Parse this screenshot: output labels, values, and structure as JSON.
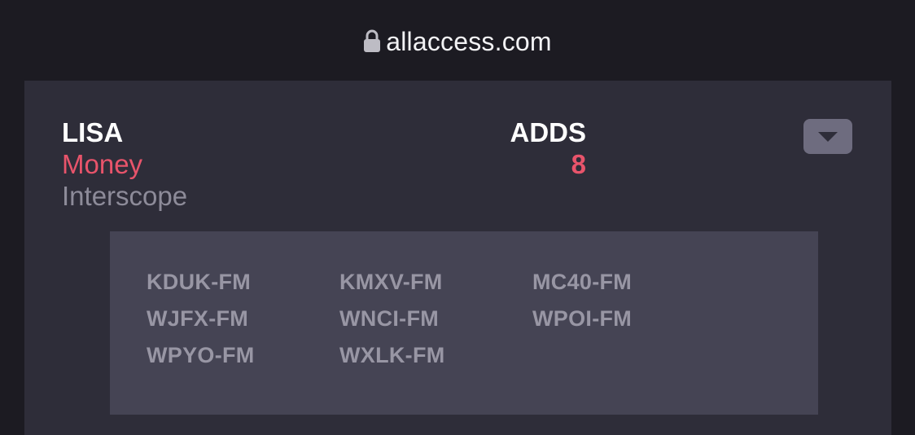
{
  "browser": {
    "url": "allaccess.com",
    "lock_icon": "lock-icon"
  },
  "entry": {
    "artist": "LISA",
    "song": "Money",
    "label": "Interscope",
    "adds_heading": "ADDS",
    "adds_count": "8",
    "toggle_icon": "triangle-down-icon"
  },
  "stations": [
    "KDUK-FM",
    "KMXV-FM",
    "MC40-FM",
    "WJFX-FM",
    "WNCI-FM",
    "WPOI-FM",
    "WPYO-FM",
    "WXLK-FM"
  ],
  "colors": {
    "background": "#1c1b22",
    "card": "#2e2d39",
    "panel": "#454454",
    "accent": "#e8546b",
    "muted": "#8d8b99"
  }
}
